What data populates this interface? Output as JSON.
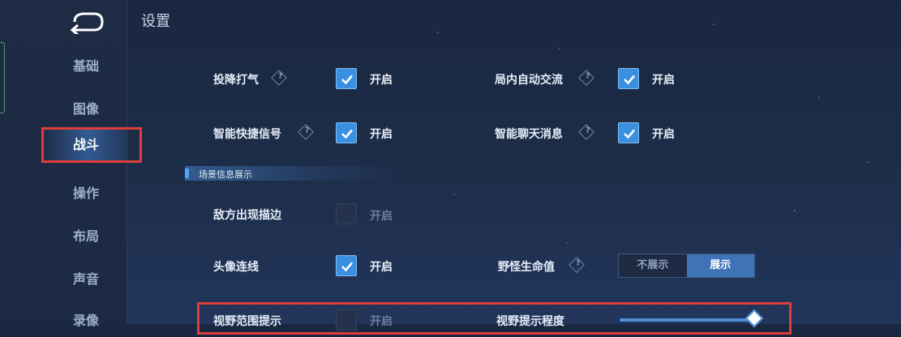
{
  "page_title": "设置",
  "sidebar": {
    "items": [
      {
        "label": "基础"
      },
      {
        "label": "图像"
      },
      {
        "label": "战斗"
      },
      {
        "label": "操作"
      },
      {
        "label": "布局"
      },
      {
        "label": "声音"
      },
      {
        "label": "录像"
      }
    ],
    "active": "战斗"
  },
  "settings": {
    "surrender_vote": {
      "label": "投降打气",
      "option": "开启",
      "checked": true
    },
    "in_game_chat": {
      "label": "局内自动交流",
      "option": "开启",
      "checked": true
    },
    "smart_signal": {
      "label": "智能快捷信号",
      "option": "开启",
      "checked": true
    },
    "smart_chat": {
      "label": "智能聊天消息",
      "option": "开启",
      "checked": true
    },
    "section_scene_info": "场景信息展示",
    "enemy_outline": {
      "label": "敌方出现描边",
      "option": "开启",
      "checked": false
    },
    "avatar_link": {
      "label": "头像连线",
      "option": "开启",
      "checked": true
    },
    "monster_hp": {
      "label": "野怪生命值",
      "options": [
        "不展示",
        "展示"
      ],
      "selected": "展示"
    },
    "vision_range": {
      "label": "视野范围提示",
      "option": "开启",
      "checked": false
    },
    "vision_hint_level": {
      "label": "视野提示程度",
      "value_fraction": 1.0
    }
  },
  "help_glyph": "?",
  "colors": {
    "accent": "#3b8fe0",
    "highlight_box": "#e03c3c"
  }
}
